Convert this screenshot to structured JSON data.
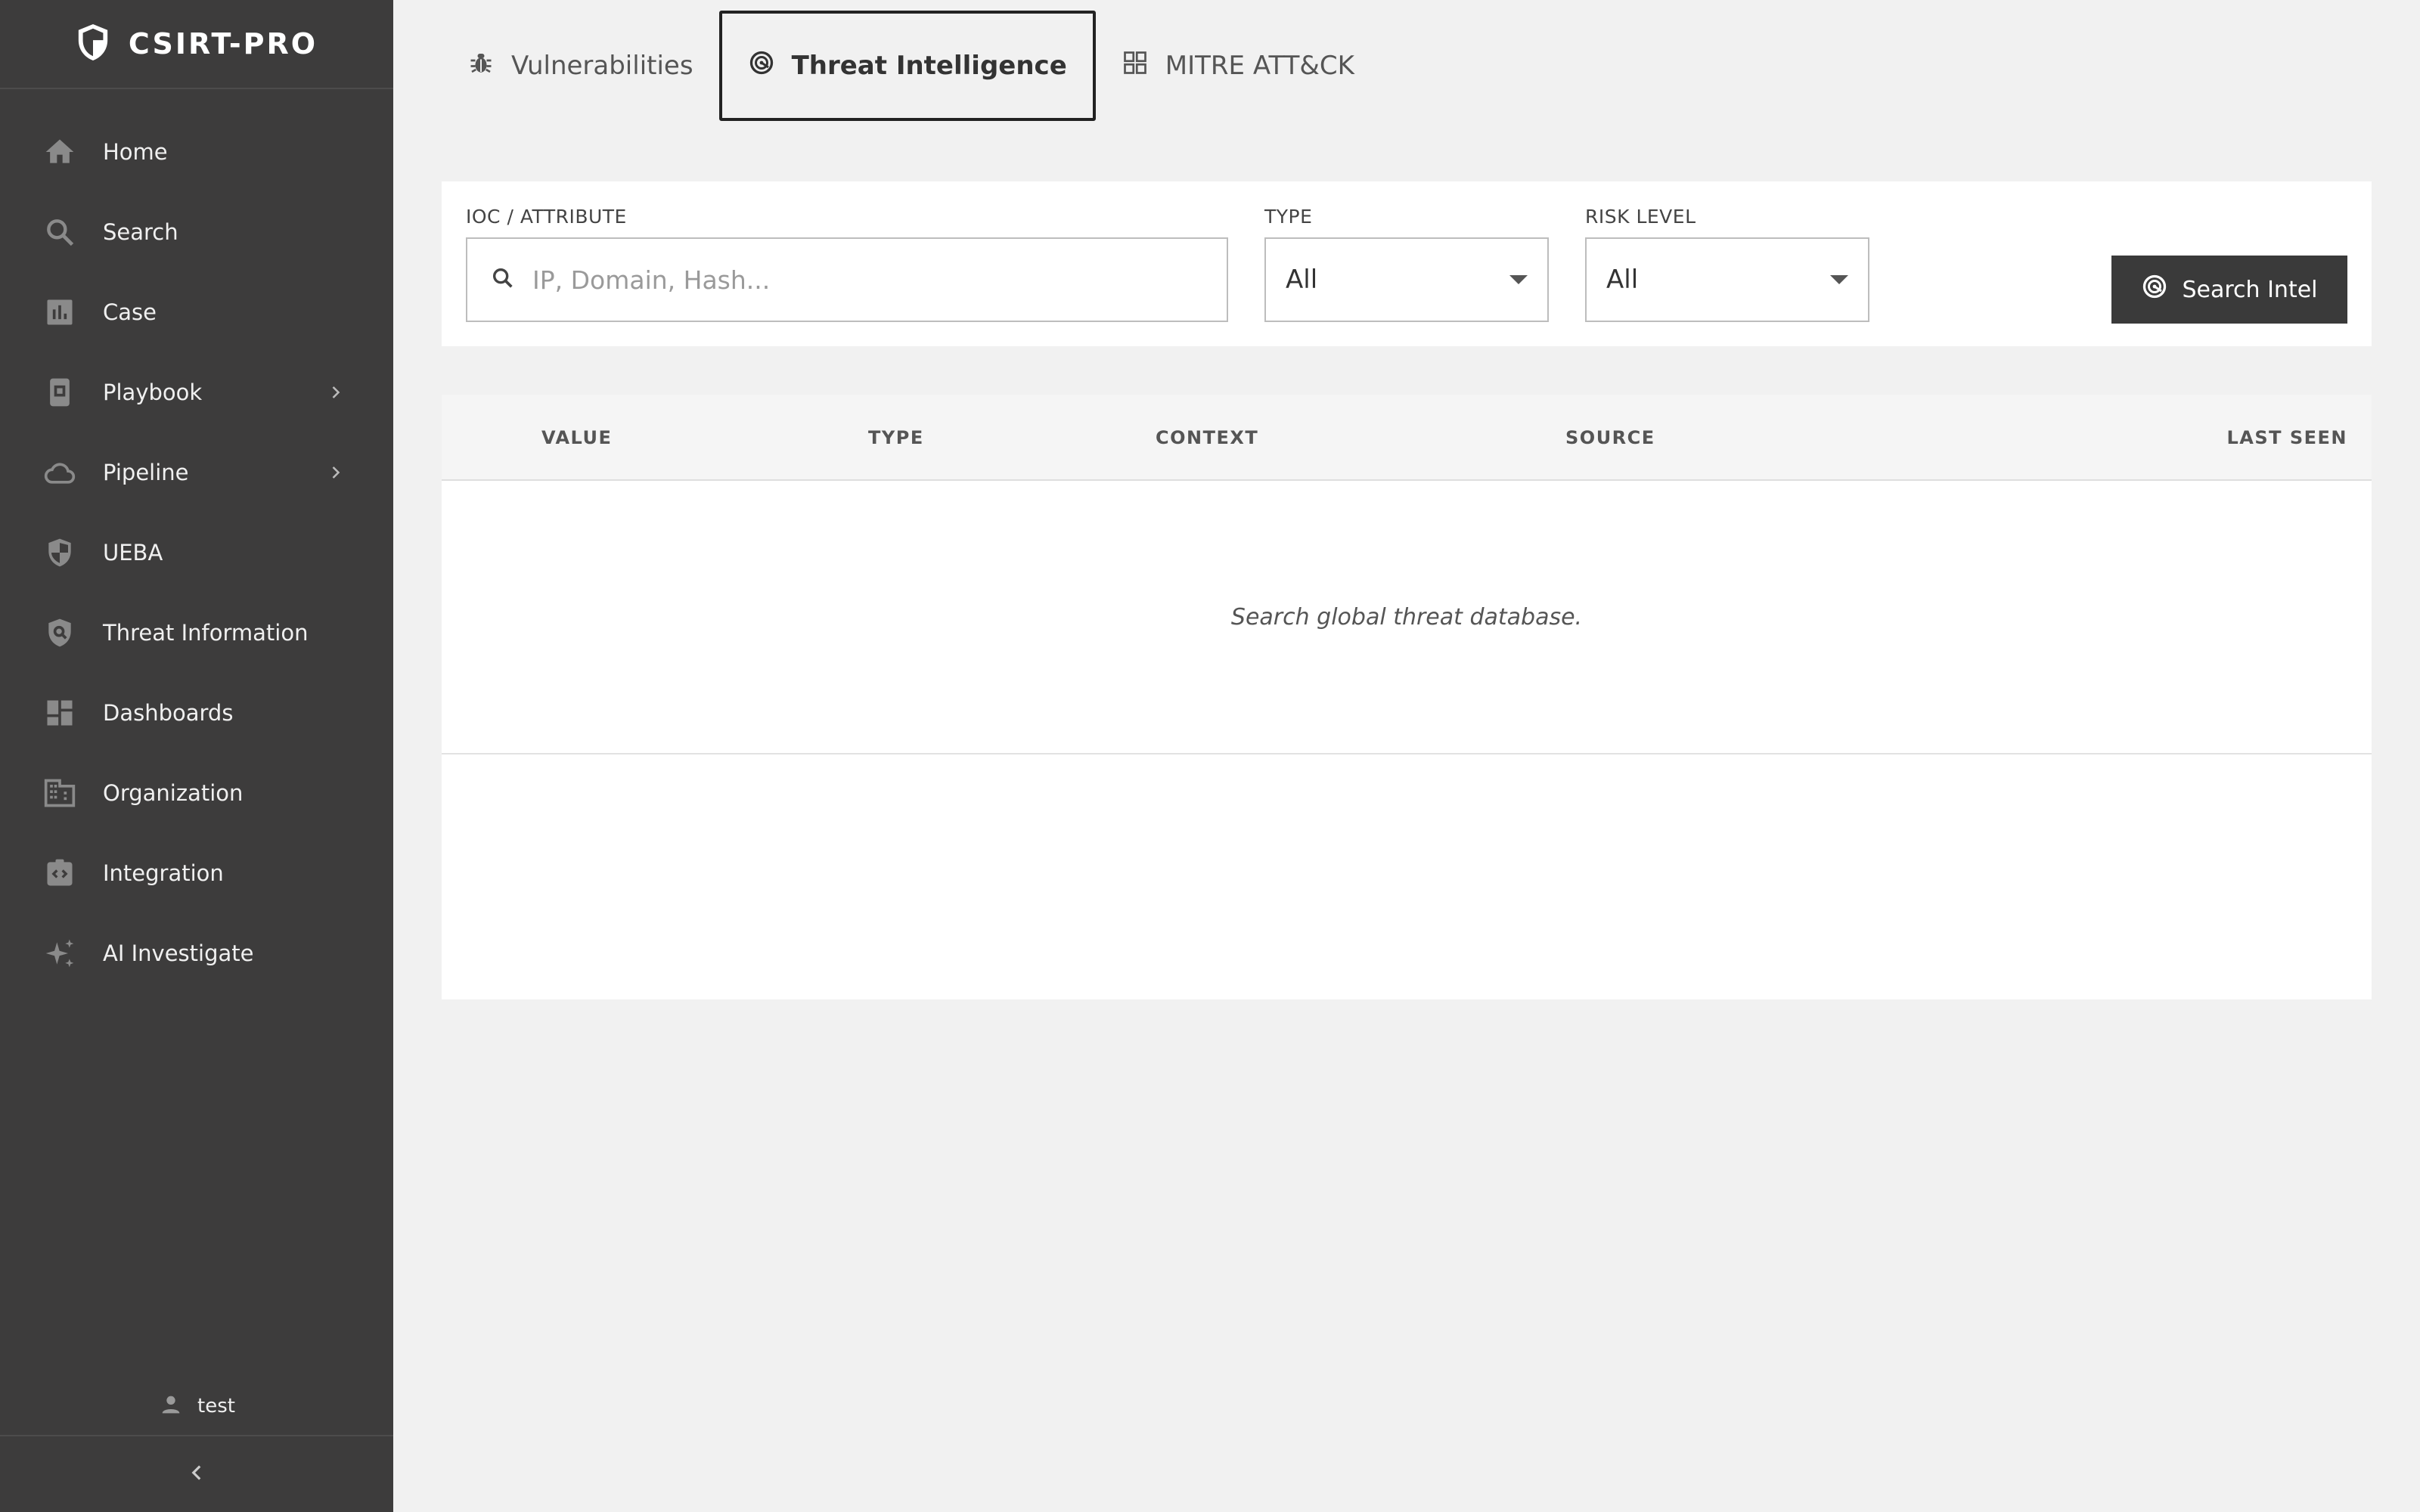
{
  "app": {
    "name": "CSIRT-PRO"
  },
  "sidebar": {
    "items": [
      {
        "label": "Home"
      },
      {
        "label": "Search"
      },
      {
        "label": "Case"
      },
      {
        "label": "Playbook"
      },
      {
        "label": "Pipeline"
      },
      {
        "label": "UEBA"
      },
      {
        "label": "Threat Information"
      },
      {
        "label": "Dashboards"
      },
      {
        "label": "Organization"
      },
      {
        "label": "Integration"
      },
      {
        "label": "AI Investigate"
      }
    ],
    "user": "test"
  },
  "tabs": [
    {
      "label": "Vulnerabilities"
    },
    {
      "label": "Threat Intelligence",
      "active": true
    },
    {
      "label": "MITRE ATT&CK"
    }
  ],
  "filters": {
    "ioc_label": "IOC / ATTRIBUTE",
    "ioc_placeholder": "IP, Domain, Hash...",
    "type_label": "TYPE",
    "type_value": "All",
    "risk_label": "RISK LEVEL",
    "risk_value": "All",
    "search_button": "Search Intel"
  },
  "table": {
    "columns": [
      "VALUE",
      "TYPE",
      "CONTEXT",
      "SOURCE",
      "LAST SEEN"
    ],
    "empty_message": "Search global threat database."
  },
  "colors": {
    "sidebar_bg": "#3d3c3c",
    "page_bg": "#f1f1f1",
    "button_bg": "#3a3a3a",
    "icon_gray": "#8a8a8a"
  }
}
